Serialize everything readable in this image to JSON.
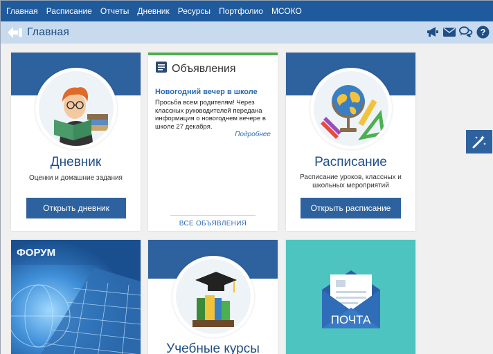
{
  "topnav": {
    "items": [
      {
        "label": "Главная"
      },
      {
        "label": "Расписание"
      },
      {
        "label": "Отчеты"
      },
      {
        "label": "Дневник"
      },
      {
        "label": "Ресурсы"
      },
      {
        "label": "Портфолио"
      },
      {
        "label": "МСОКО"
      }
    ]
  },
  "subheader": {
    "title": "Главная",
    "icons": [
      "megaphone-icon",
      "envelope-icon",
      "chat-icon",
      "help-icon"
    ]
  },
  "cards": {
    "diary": {
      "title": "Дневник",
      "desc": "Оценки и домашние задания",
      "button": "Открыть дневник"
    },
    "announcements": {
      "title": "Объявления",
      "item_title": "Новогодний вечер в школе",
      "item_text": "Просьба всем родителям! Через классных руководителей передана информация о новогоднем вечере в школе 27 декабря.",
      "more": "Подробнее",
      "all": "ВСЕ ОБЪЯВЛЕНИЯ"
    },
    "schedule": {
      "title": "Расписание",
      "desc": "Расписание уроков, классных и школьных мероприятий",
      "button": "Открыть расписание"
    },
    "forum": {
      "label": "ФОРУМ"
    },
    "courses": {
      "title": "Учебные курсы"
    },
    "mail": {
      "label": "ПОЧТА"
    }
  },
  "colors": {
    "nav": "#1f5a9c",
    "accent": "#2e629e",
    "subheader": "#c8dbee",
    "announcement_bar": "#4caf50",
    "mail": "#4dc4c0"
  }
}
